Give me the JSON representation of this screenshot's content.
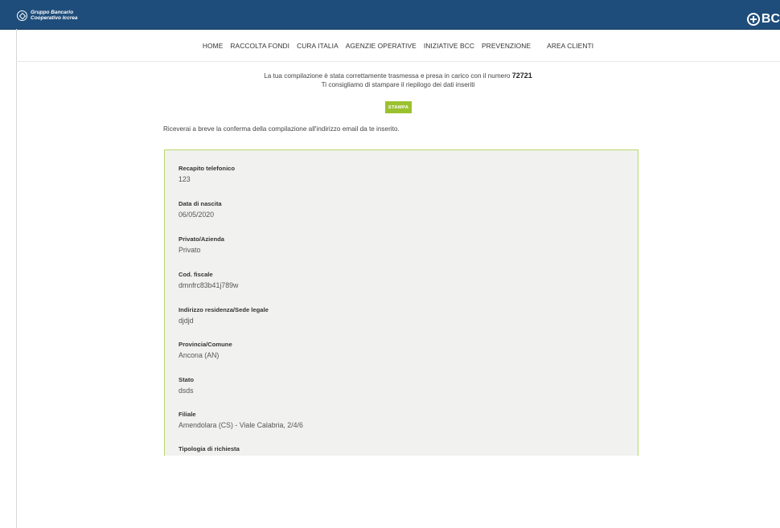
{
  "header": {
    "logo_left_line1": "Gruppo Bancario",
    "logo_left_line2": "Cooperativo Iccrea",
    "logo_right": "BC",
    "colors": {
      "bar": "#1e4d7b",
      "accent": "#9cc12e",
      "panel_border": "#b9d86a"
    }
  },
  "nav": {
    "items": [
      "HOME",
      "RACCOLTA FONDI",
      "CURA ITALIA",
      "AGENZIE OPERATIVE",
      "INIZIATIVE BCC",
      "PREVENZIONE",
      "AREA CLIENTI"
    ]
  },
  "confirmation": {
    "line1": "La tua compilazione è stata correttamente trasmessa e presa in carico con il numero ",
    "number": "72721",
    "line2": "Ti consigliamo di stampare il riepilogo dei dati inseriti",
    "print_button": "STAMPA",
    "note": "Riceverai a breve la conferma della compilazione all'indirizzo email da te inserito."
  },
  "summary": {
    "fields": [
      {
        "label": "Recapito telefonico",
        "value": "123"
      },
      {
        "label": "Data di nascita",
        "value": "06/05/2020"
      },
      {
        "label": "Privato/Azienda",
        "value": "Privato"
      },
      {
        "label": "Cod. fiscale",
        "value": "dmnfrc83b41j789w"
      },
      {
        "label": "Indirizzo residenza/Sede legale",
        "value": "djdjd"
      },
      {
        "label": "Provincia/Comune",
        "value": "Ancona (AN)"
      },
      {
        "label": "Stato",
        "value": "dsds"
      },
      {
        "label": "Filiale",
        "value": "Amendolara (CS) - Viale Calabria, 2/4/6"
      },
      {
        "label": "Tipologia di richiesta",
        "value": ""
      }
    ]
  }
}
